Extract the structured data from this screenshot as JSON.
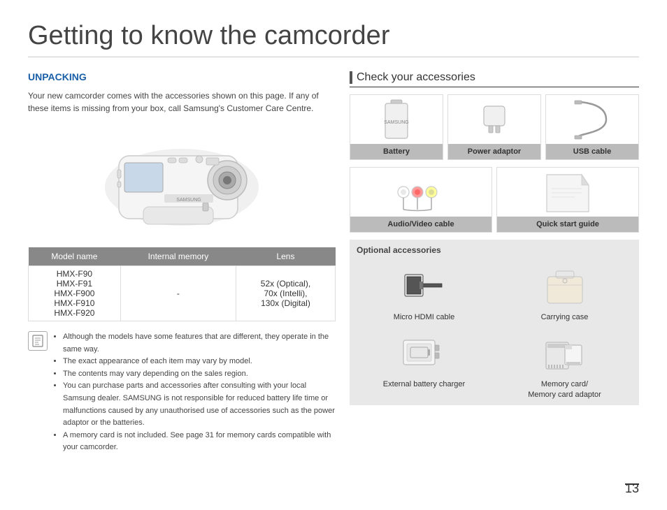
{
  "page": {
    "title": "Getting to know the camcorder",
    "page_number": "13"
  },
  "left": {
    "section_title": "UNPACKING",
    "intro_text": "Your new camcorder comes with the accessories shown on this page. If any of these items is missing from your box, call Samsung's Customer Care Centre.",
    "table": {
      "headers": [
        "Model name",
        "Internal memory",
        "Lens"
      ],
      "rows": [
        {
          "model": "HMX-F90",
          "memory": "",
          "lens": ""
        },
        {
          "model": "HMX-F91",
          "memory": "",
          "lens": ""
        },
        {
          "model": "HMX-F900",
          "memory": "-",
          "lens": "52x (Optical),"
        },
        {
          "model": "HMX-F910",
          "memory": "",
          "lens": "70x (Intelli),"
        },
        {
          "model": "HMX-F920",
          "memory": "",
          "lens": "130x (Digital)"
        }
      ]
    },
    "notes": [
      "Although the models have some features that are different, they operate in the same way.",
      "The exact appearance of each item may vary by model.",
      "The contents may vary depending on the sales region.",
      "You can purchase parts and accessories after consulting with your local Samsung dealer. SAMSUNG is not responsible for reduced battery life time or malfunctions caused by any unauthorised use of accessories such as the power adaptor or the batteries.",
      "A memory card is not included. See page 31 for memory cards compatible with your camcorder."
    ]
  },
  "right": {
    "check_title": "Check your accessories",
    "accessories": [
      {
        "label": "Battery",
        "has_label": true
      },
      {
        "label": "Power adaptor",
        "has_label": true
      },
      {
        "label": "USB cable",
        "has_label": true
      },
      {
        "label": "Audio/Video cable",
        "has_label": true
      },
      {
        "label": "Quick start guide",
        "has_label": true
      }
    ],
    "optional_title": "Optional accessories",
    "optional_items": [
      {
        "label": "Micro HDMI cable"
      },
      {
        "label": "Carrying case"
      },
      {
        "label": "External battery charger"
      },
      {
        "label": "Memory card/\nMemory card adaptor"
      }
    ]
  }
}
